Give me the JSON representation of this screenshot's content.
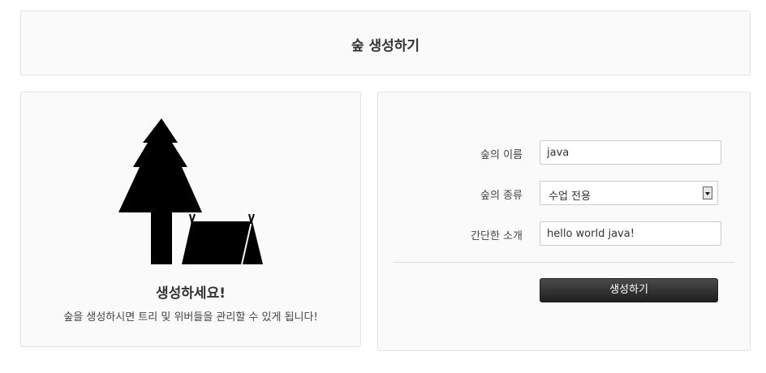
{
  "header": {
    "title": "숲 생성하기"
  },
  "welcome": {
    "illustration_icon": "tree-and-tent-icon",
    "title": "생성하세요!",
    "description": "숲을 생성하시면 트리 및 위버들을 관리할 수 있게 됩니다!"
  },
  "form": {
    "name_label": "숲의 이름",
    "name_value": "java",
    "type_label": "숲의 종류",
    "type_value": "수업 전용",
    "intro_label": "간단한 소개",
    "intro_value": "hello world java!",
    "submit_label": "생성하기"
  },
  "colors": {
    "button_background": "#2b2b2b",
    "panel_background": "#fafafa",
    "panel_border": "#e2e2e2"
  }
}
